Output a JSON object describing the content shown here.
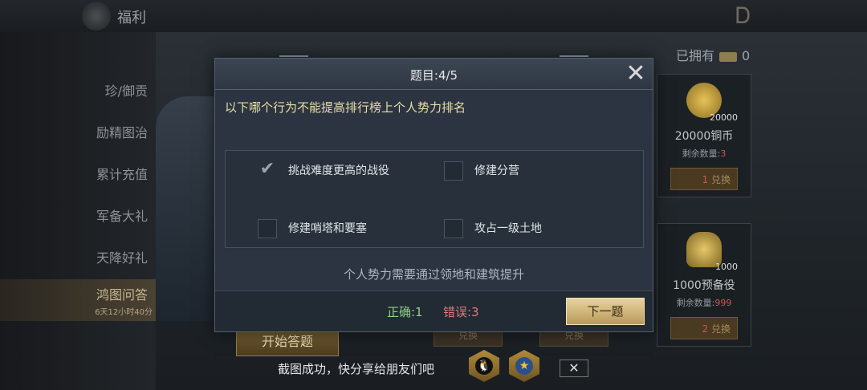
{
  "header": {
    "title": "福利"
  },
  "sidebar": {
    "items": [
      {
        "label": "珍/御贡"
      },
      {
        "label": "励精图治"
      },
      {
        "label": "累计充值"
      },
      {
        "label": "军备大礼"
      },
      {
        "label": "天降好礼"
      },
      {
        "label": "鸿图问答",
        "sub": "6天12小时40分",
        "active": true
      }
    ]
  },
  "owned": {
    "label": "已拥有",
    "count": "0"
  },
  "shop": {
    "cards": [
      {
        "amount": "20000",
        "name": "20000铜币",
        "stock_label": "剩余数量:",
        "stock_value": "3",
        "price": "1",
        "button": "兑换"
      },
      {
        "amount": "1000",
        "name": "1000预备役",
        "stock_label": "剩余数量:",
        "stock_value": "999",
        "price": "2",
        "button": "兑换"
      }
    ],
    "faded_button": "兑换"
  },
  "start_button": "开始答题",
  "modal": {
    "title": "题目:4/5",
    "question": "以下哪个行为不能提高排行榜上个人势力排名",
    "options": [
      {
        "label": "挑战难度更高的战役",
        "checked": true
      },
      {
        "label": "修建分营",
        "checked": false
      },
      {
        "label": "修建哨塔和要塞",
        "checked": false
      },
      {
        "label": "攻占一级土地",
        "checked": false
      }
    ],
    "hint": "个人势力需要通过领地和建筑提升",
    "correct": "正确:1",
    "wrong": "错误:3",
    "next_button": "下一题"
  },
  "share": {
    "text": "截图成功，快分享给朋友们吧",
    "close": "✕"
  },
  "icons": {
    "close": "close-icon",
    "check": "checkmark-icon",
    "qq": "qq-penguin-icon",
    "qzone": "qzone-star-icon",
    "dragon": "dragon-logo-icon"
  },
  "colors": {
    "accent": "#e8d39e",
    "correct": "#8fd08a",
    "wrong": "#e07a7a",
    "question": "#e9dfa8"
  }
}
